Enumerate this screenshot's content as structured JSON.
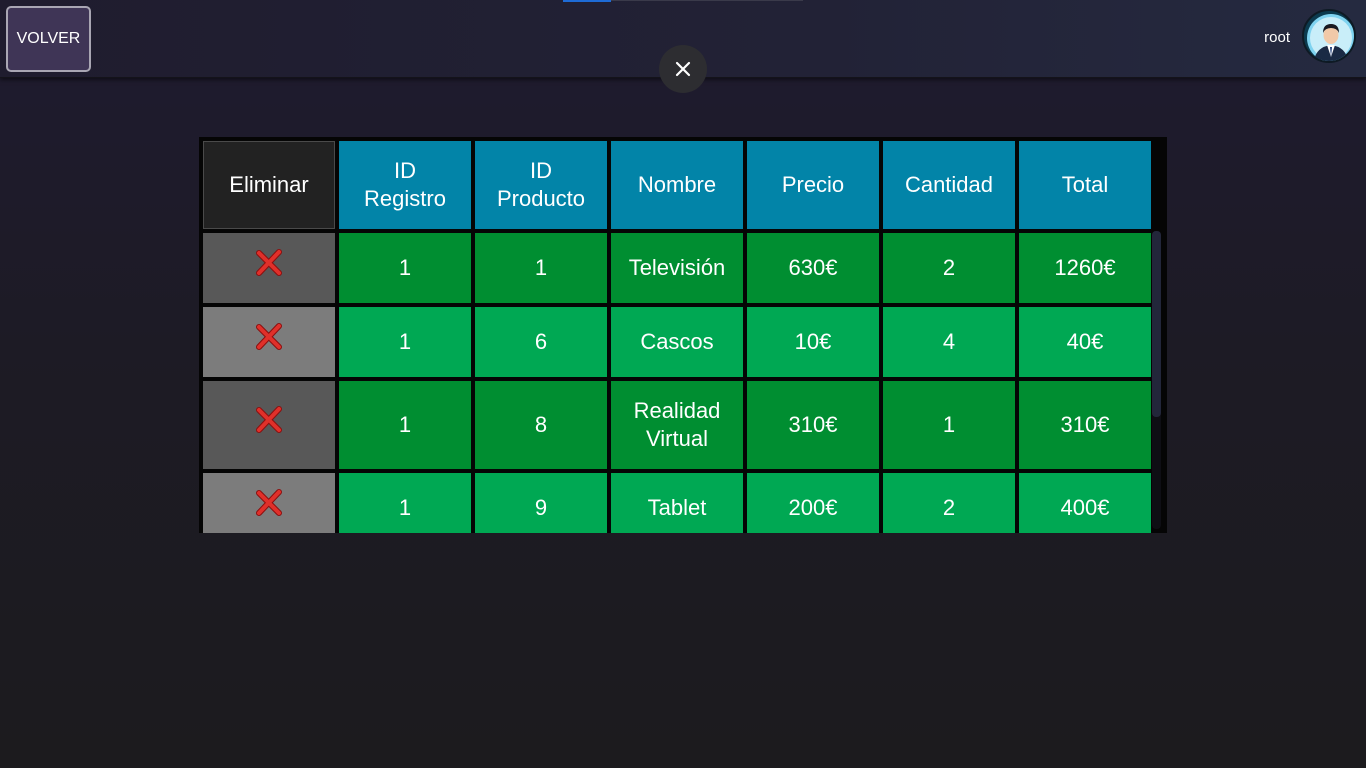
{
  "header": {
    "back_label": "VOLVER",
    "username": "root",
    "close_symbol": "✕",
    "avatar_icon": "user-avatar-icon"
  },
  "table": {
    "columns": [
      "Eliminar",
      "ID\nRegistro",
      "ID\nProducto",
      "Nombre",
      "Precio",
      "Cantidad",
      "Total"
    ],
    "rows": [
      {
        "id_registro": "1",
        "id_producto": "1",
        "nombre": "Televisión",
        "precio": "630€",
        "cantidad": "2",
        "total": "1260€"
      },
      {
        "id_registro": "1",
        "id_producto": "6",
        "nombre": "Cascos",
        "precio": "10€",
        "cantidad": "4",
        "total": "40€"
      },
      {
        "id_registro": "1",
        "id_producto": "8",
        "nombre": "Realidad Virtual",
        "precio": "310€",
        "cantidad": "1",
        "total": "310€"
      },
      {
        "id_registro": "1",
        "id_producto": "9",
        "nombre": "Tablet",
        "precio": "200€",
        "cantidad": "2",
        "total": "400€"
      }
    ],
    "delete_icon": "delete-x-icon"
  },
  "colors": {
    "header_cell": "#0284a8",
    "row_dark": "#008e31",
    "row_light": "#00a853",
    "delete_red": "#d8231f"
  }
}
